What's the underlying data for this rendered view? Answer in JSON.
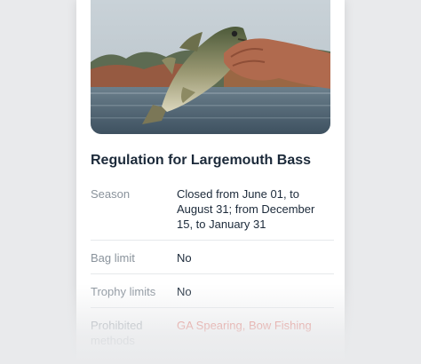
{
  "photo": {
    "subject": "largemouth-bass-photo"
  },
  "regulation": {
    "title": "Regulation for Largemouth Bass",
    "rows": [
      {
        "label": "Season",
        "value": "Closed from June 01, to August 31; from December 15, to January 31"
      },
      {
        "label": "Bag limit",
        "value": "No"
      },
      {
        "label": "Trophy limits",
        "value": "No"
      },
      {
        "label": "Prohibited methods",
        "value": "GA Spearing, Bow Fishing"
      }
    ]
  },
  "colors": {
    "background": "#e9eaec",
    "text": "#1c2a3a",
    "label": "#8a939c",
    "alert": "#e2574c"
  }
}
